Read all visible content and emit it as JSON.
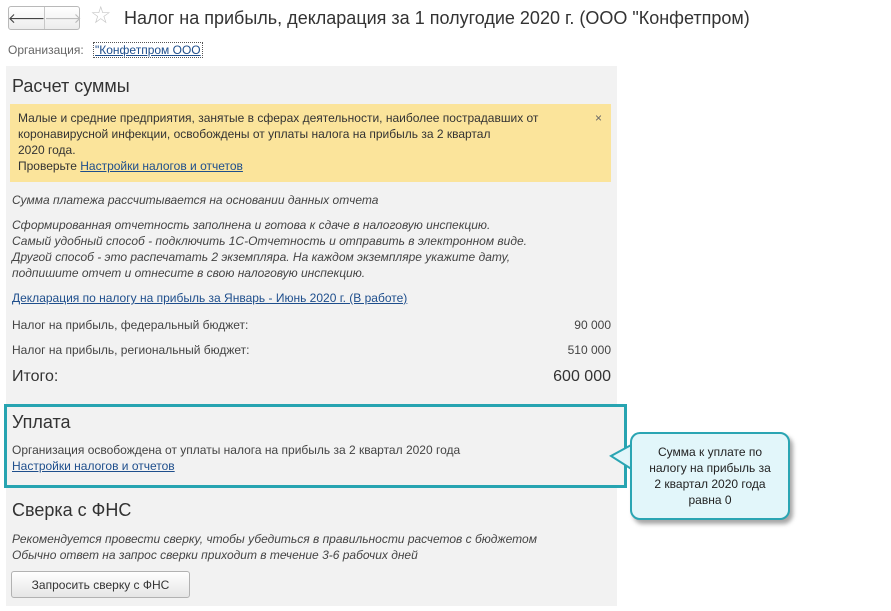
{
  "header": {
    "back_arrow": "🡐",
    "forward_arrow": "🡒",
    "star": "☆",
    "title": "Налог на прибыль, декларация за 1 полугодие 2020 г. (ООО \"Конфетпром)"
  },
  "organization": {
    "label": "Организация:",
    "value": "\"Конфетпром ООО"
  },
  "calculation": {
    "title": "Расчет суммы",
    "notice": {
      "line1": "Малые и средние предприятия, занятые в сферах деятельности, наиболее пострадавших от",
      "line2": "коронавирусной инфекции, освобождены от уплаты налога на прибыль за 2 квартал",
      "line3": "2020 года.",
      "check_prefix": "Проверьте ",
      "check_link": "Настройки налогов и отчетов",
      "close": "×"
    },
    "basis_note": "Сумма платежа рассчитывается на основании данных отчета",
    "report_note": {
      "line1": "Сформированная отчетность заполнена и готова к сдаче в налоговую инспекцию.",
      "line2": "Самый удобный способ - подключить 1С-Отчетность и отправить в электронном виде.",
      "line3": "Другой способ - это распечатать 2 экземпляра. На каждом экземпляре укажите дату,",
      "line4": "подпишите отчет и отнесите в свою налоговую инспекцию."
    },
    "declaration_link": "Декларация по налогу на прибыль за Январь - Июнь 2020 г. (В работе)",
    "rows": [
      {
        "label": "Налог на прибыль, федеральный бюджет:",
        "value": "90 000"
      },
      {
        "label": "Налог на прибыль, региональный бюджет:",
        "value": "510 000"
      }
    ],
    "total_label": "Итого:",
    "total_value": "600 000"
  },
  "payment": {
    "title": "Уплата",
    "text": "Организация освобождена от уплаты налога на прибыль за 2 квартал 2020 года",
    "link": "Настройки налогов и отчетов"
  },
  "reconciliation": {
    "title": "Сверка с ФНС",
    "line1": "Рекомендуется провести сверку, чтобы убедиться в правильности расчетов с бюджетом",
    "line2": "Обычно ответ на запрос сверки приходит в течение 3-6 рабочих дней",
    "button": "Запросить сверку с ФНС"
  },
  "callout": {
    "line1": "Сумма к уплате по",
    "line2": "налогу на прибыль за",
    "line3": "2 квартал 2020 года",
    "line4": "равна 0"
  },
  "colors": {
    "accent": "#27a4b1",
    "notice_bg": "#fbe49b",
    "link": "#1e4e8c",
    "panel_bg": "#f2f2f2"
  }
}
